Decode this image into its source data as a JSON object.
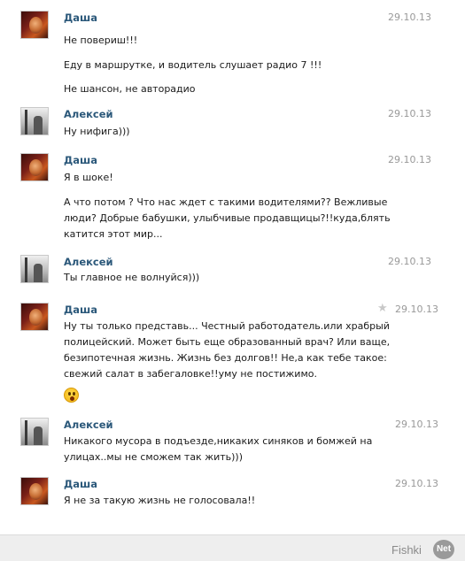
{
  "messages": [
    {
      "author": "Даша",
      "date": "29.10.13",
      "lines": [
        "Не повериш!!!",
        "Еду в маршрутке, и водитель слушает радио 7 !!!",
        "Не шансон, не авторадио"
      ]
    },
    {
      "author": "Алексей",
      "date": "29.10.13",
      "lines": [
        "Ну нифига)))"
      ]
    },
    {
      "author": "Даша",
      "date": "29.10.13",
      "lines": [
        "Я в шоке!",
        "А что потом ? Что нас ждет с такими водителями?? Вежливые",
        "люди? Добрые бабушки, улыбчивые продавщицы?!!куда,блять",
        "катится этот мир..."
      ]
    },
    {
      "author": "Алексей",
      "date": "29.10.13",
      "lines": [
        "Ты главное не волнуйся)))"
      ]
    },
    {
      "author": "Даша",
      "date": "29.10.13",
      "starred": true,
      "lines": [
        "Ну ты только представь... Честный работодатель.или храбрый",
        "полицейский. Может быть еще образованный врач? Или ваще,",
        "безипотечная жизнь. Жизнь без долгов!! Не,а как тебе такое:",
        "свежий салат в забегаловке!!уму не постижимо."
      ],
      "emoji": "shocked-face"
    },
    {
      "author": "Алексей",
      "date": "29.10.13",
      "lines": [
        "Никакого мусора в подъезде,никаких синяков и бомжей на",
        "улицах..мы не сможем так жить)))"
      ]
    },
    {
      "author": "Даша",
      "date": "29.10.13",
      "lines": [
        "Я не за такую жизнь не голосовала!!"
      ]
    }
  ],
  "footer": {
    "brand": "Fishki",
    "badge": "Net"
  },
  "colors": {
    "author_link": "#2b587a",
    "date": "#999999",
    "footer_bg": "#eeeeee"
  }
}
